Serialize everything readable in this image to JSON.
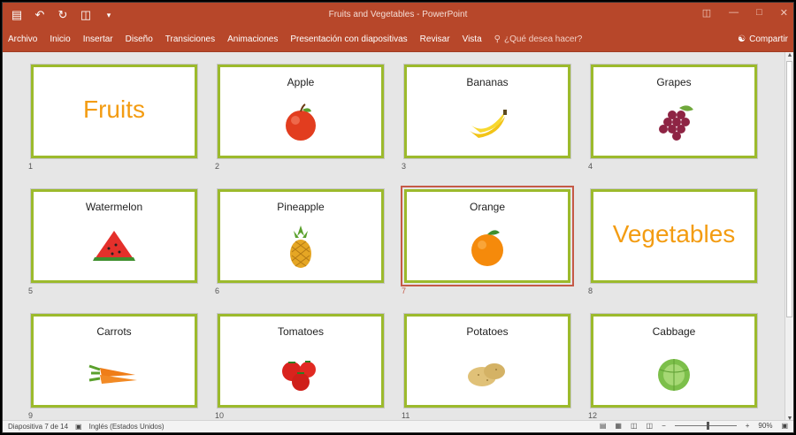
{
  "window": {
    "doc_title": "Fruits and Vegetables - PowerPoint",
    "share_label": "Compartir",
    "qat_icons": [
      "save-icon",
      "undo-icon",
      "redo-icon",
      "start-slideshow-icon",
      "customize-qat-icon"
    ]
  },
  "ribbon": {
    "tabs": [
      "Archivo",
      "Inicio",
      "Insertar",
      "Diseño",
      "Transiciones",
      "Animaciones",
      "Presentación con diapositivas",
      "Revisar",
      "Vista"
    ],
    "tell_me": "¿Qué desea hacer?"
  },
  "slides": [
    {
      "num": "1",
      "title": "",
      "big": "Fruits",
      "art": "none"
    },
    {
      "num": "2",
      "title": "Apple",
      "big": "",
      "art": "apple"
    },
    {
      "num": "3",
      "title": "Bananas",
      "big": "",
      "art": "bananas"
    },
    {
      "num": "4",
      "title": "Grapes",
      "big": "",
      "art": "grapes"
    },
    {
      "num": "5",
      "title": "Watermelon",
      "big": "",
      "art": "watermelon"
    },
    {
      "num": "6",
      "title": "Pineapple",
      "big": "",
      "art": "pineapple"
    },
    {
      "num": "7",
      "title": "Orange",
      "big": "",
      "art": "orange",
      "selected": true
    },
    {
      "num": "8",
      "title": "",
      "big": "Vegetables",
      "art": "none"
    },
    {
      "num": "9",
      "title": "Carrots",
      "big": "",
      "art": "carrots"
    },
    {
      "num": "10",
      "title": "Tomatoes",
      "big": "",
      "art": "tomatoes"
    },
    {
      "num": "11",
      "title": "Potatoes",
      "big": "",
      "art": "potatoes"
    },
    {
      "num": "12",
      "title": "Cabbage",
      "big": "",
      "art": "cabbage"
    }
  ],
  "statusbar": {
    "slide_info": "Diapositiva 7 de 14",
    "language": "Inglés (Estados Unidos)",
    "zoom": "90%"
  },
  "colors": {
    "accent": "#b7472a",
    "slide_border": "#9cba2c",
    "title_orange": "#f39c12",
    "selection": "#c55a47"
  }
}
